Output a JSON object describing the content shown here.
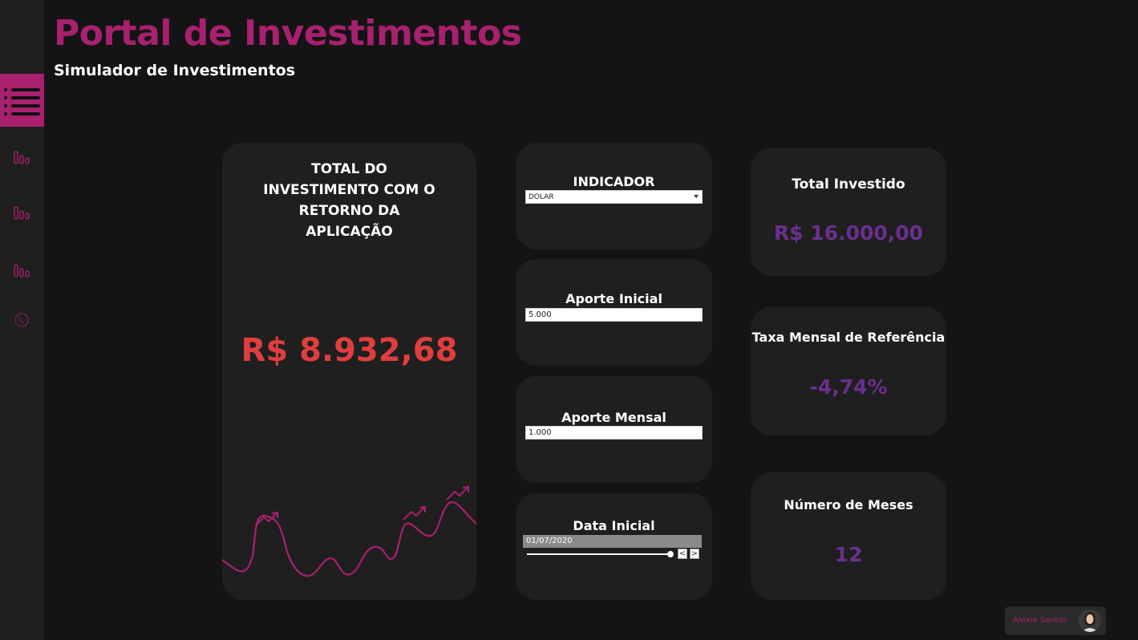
{
  "header": {
    "title": "Portal de Investimentos",
    "subtitle": "Simulador de Investimentos"
  },
  "sidebar": {
    "items": [
      {
        "icon": "list-icon",
        "active": true
      },
      {
        "icon": "bar-chart-icon"
      },
      {
        "icon": "bar-chart-icon"
      },
      {
        "icon": "bar-chart-icon"
      },
      {
        "icon": "whatsapp-icon"
      }
    ]
  },
  "main_card": {
    "label": "TOTAL DO INVESTIMENTO COM O RETORNO DA APLICAÇÃO",
    "value": "R$ 8.932,68"
  },
  "filters": {
    "indicador": {
      "label": "INDICADOR",
      "selected": "DOLAR"
    },
    "aporte_inicial": {
      "label": "Aporte Inicial",
      "value": "5.000"
    },
    "aporte_mensal": {
      "label": "Aporte Mensal",
      "value": "1.000"
    },
    "data_inicial": {
      "label": "Data Inicial",
      "value": "01/07/2020",
      "prev": "<",
      "next": ">"
    }
  },
  "kpis": {
    "total_investido": {
      "label": "Total Investido",
      "value": "R$ 16.000,00"
    },
    "taxa_mensal": {
      "label": "Taxa Mensal de Referência",
      "value": "-4,74%"
    },
    "numero_meses": {
      "label": "Número de Meses",
      "value": "12"
    }
  },
  "user": {
    "name": "Alexia Santos"
  },
  "colors": {
    "brand": "#a8206e",
    "value_red": "#e03e3e",
    "kpi_purple": "#6b2f8f",
    "background": "#141414",
    "card": "#1f1f1f"
  }
}
